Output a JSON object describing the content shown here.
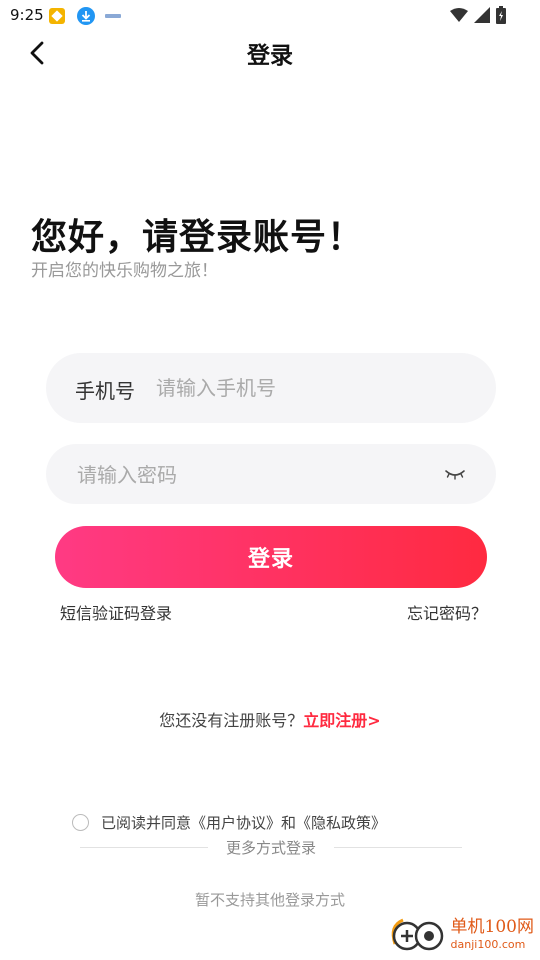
{
  "status_bar": {
    "time": "9:25"
  },
  "nav": {
    "title": "登录"
  },
  "greeting": {
    "title": "您好，请登录账号！",
    "subtitle": "开启您的快乐购物之旅！"
  },
  "phone": {
    "label": "手机号",
    "placeholder": "请输入手机号",
    "value": ""
  },
  "password": {
    "placeholder": "请输入密码",
    "value": ""
  },
  "login_button": "登录",
  "links": {
    "sms_login": "短信验证码登录",
    "forgot": "忘记密码？"
  },
  "register": {
    "prompt": "您还没有注册账号？",
    "link": "立即注册>"
  },
  "agreement": {
    "text": "已阅读并同意《用户协议》和《隐私政策》",
    "checked": false
  },
  "more_methods": {
    "label": "更多方式登录",
    "note": "暂不支持其他登录方式"
  },
  "watermark": {
    "name": "单机100网",
    "domain": "danji100.com"
  },
  "colors": {
    "accent": "#ff2a40",
    "gradient_start": "#ff3a84",
    "field_bg": "#f5f5f7"
  }
}
